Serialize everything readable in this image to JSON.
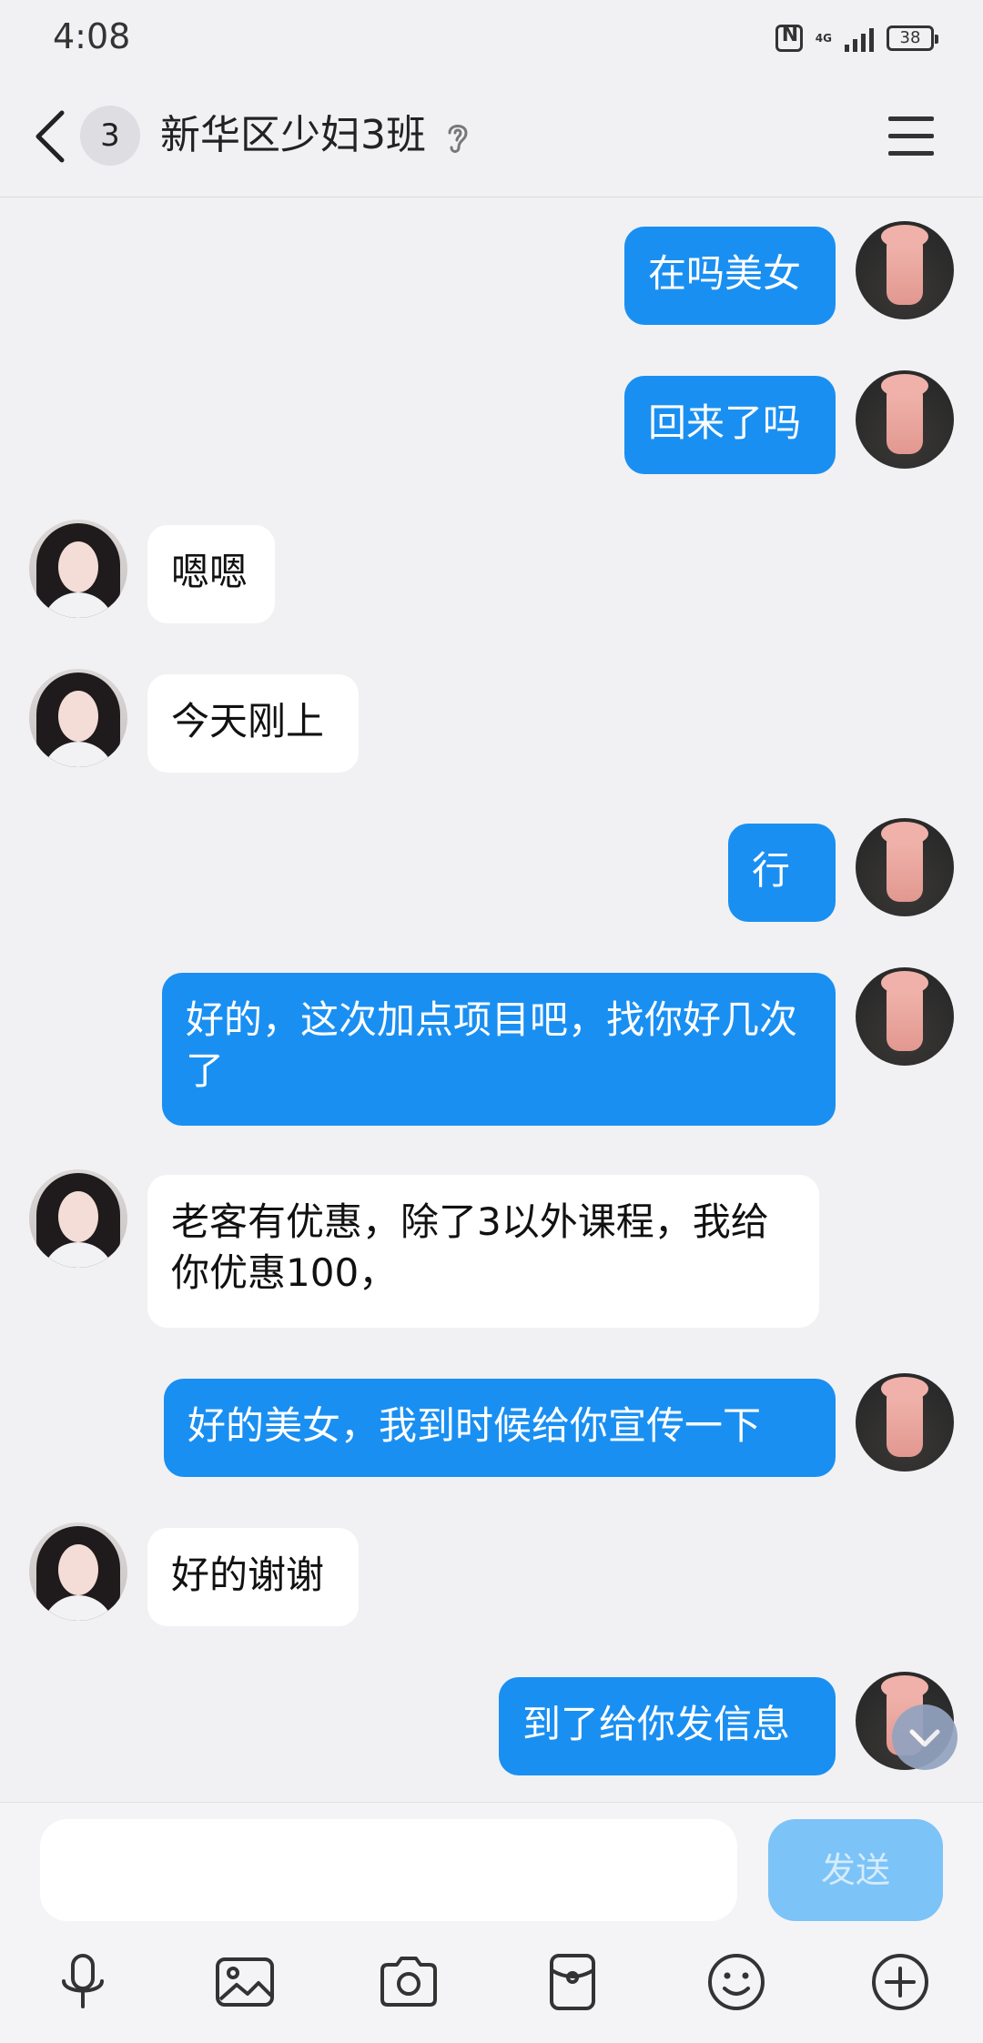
{
  "status_bar": {
    "time": "4:08",
    "network": "4G",
    "battery": "38"
  },
  "header": {
    "member_count": "3",
    "title": "新华区少妇3班"
  },
  "messages": [
    {
      "side": "self",
      "text": "在吗美女"
    },
    {
      "side": "self",
      "text": "回来了吗"
    },
    {
      "side": "other",
      "text": "嗯嗯"
    },
    {
      "side": "other",
      "text": "今天刚上"
    },
    {
      "side": "self",
      "text": "行"
    },
    {
      "side": "self",
      "text": "好的，这次加点项目吧，找你好几次了"
    },
    {
      "side": "other",
      "text": "老客有优惠，除了3以外课程，我给你优惠100，"
    },
    {
      "side": "self",
      "text": "好的美女，我到时候给你宣传一下"
    },
    {
      "side": "other",
      "text": "好的谢谢"
    },
    {
      "side": "self",
      "text": "到了给你发信息"
    }
  ],
  "input": {
    "placeholder": ""
  },
  "send_button": {
    "label": "发送"
  },
  "toolbar": [
    "mic-icon",
    "image-icon",
    "camera-icon",
    "red-packet-icon",
    "emoji-icon",
    "plus-icon"
  ],
  "colors": {
    "self_bubble": "#1A8FF2",
    "other_bubble": "#FFFFFF",
    "send_disabled": "#7CC3F8",
    "background": "#F1F1F3"
  }
}
